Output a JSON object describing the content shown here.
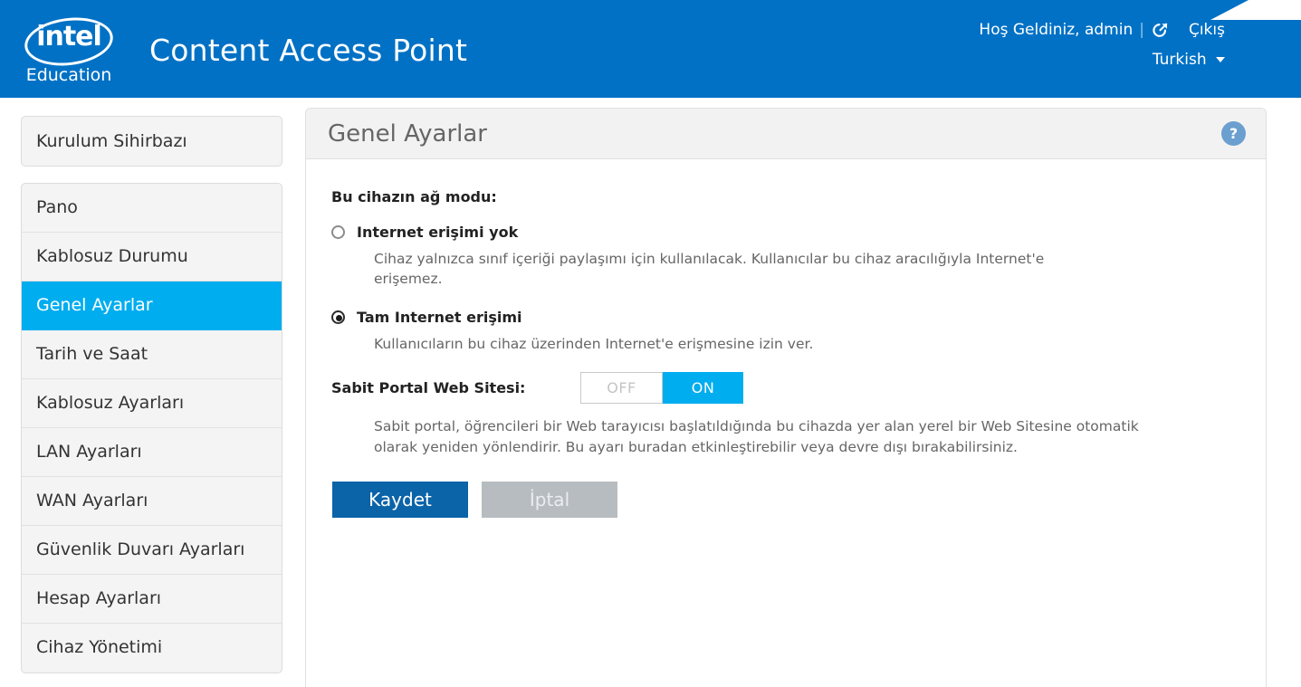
{
  "header": {
    "logo_word": "intel",
    "logo_sub": "Education",
    "app_title": "Content Access Point",
    "welcome": "Hoş Geldiniz, admin",
    "separator": "|",
    "logout_icon": "external-link-logout-icon",
    "logout_label": "Çıkış",
    "language": "Turkish",
    "brand_color": "#0071c5"
  },
  "sidebar": {
    "standalone": {
      "label": "Kurulum Sihirbazı"
    },
    "items": [
      {
        "label": "Pano",
        "active": false
      },
      {
        "label": "Kablosuz Durumu",
        "active": false
      },
      {
        "label": "Genel Ayarlar",
        "active": true
      },
      {
        "label": "Tarih ve Saat",
        "active": false
      },
      {
        "label": "Kablosuz Ayarları",
        "active": false
      },
      {
        "label": "LAN Ayarları",
        "active": false
      },
      {
        "label": "WAN Ayarları",
        "active": false
      },
      {
        "label": "Güvenlik Duvarı Ayarları",
        "active": false
      },
      {
        "label": "Hesap Ayarları",
        "active": false
      },
      {
        "label": "Cihaz Yönetimi",
        "active": false
      }
    ],
    "active_color": "#00adef"
  },
  "panel": {
    "title": "Genel Ayarlar",
    "help_icon_label": "?",
    "network_mode_label": "Bu cihazın ağ modu:",
    "radio_options": [
      {
        "label": "Internet erişimi yok",
        "selected": false,
        "description": "Cihaz yalnızca sınıf içeriği paylaşımı için kullanılacak. Kullanıcılar bu cihaz aracılığıyla Internet'e erişemez."
      },
      {
        "label": "Tam Internet erişimi",
        "selected": true,
        "description": "Kullanıcıların bu cihaz üzerinden Internet'e erişmesine izin ver."
      }
    ],
    "captive_portal": {
      "label": "Sabit Portal Web Sitesi:",
      "off_label": "OFF",
      "on_label": "ON",
      "state": "ON",
      "description": "Sabit portal, öğrencileri bir Web tarayıcısı başlatıldığında bu cihazda yer alan yerel bir Web Sitesine otomatik olarak yeniden yönlendirir. Bu ayarı buradan etkinleştirebilir veya devre dışı bırakabilirsiniz."
    },
    "buttons": {
      "save": "Kaydet",
      "cancel": "İptal"
    }
  }
}
